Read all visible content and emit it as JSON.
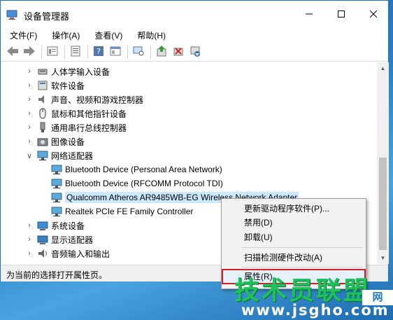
{
  "window": {
    "title": "设备管理器"
  },
  "titlebar": {
    "minimize_icon": "minimize-icon",
    "maximize_icon": "maximize-icon",
    "close_icon": "close-icon"
  },
  "menubar": {
    "items": [
      {
        "label": "文件(F)"
      },
      {
        "label": "操作(A)"
      },
      {
        "label": "查看(V)"
      },
      {
        "label": "帮助(H)"
      }
    ]
  },
  "toolbar": {
    "buttons": [
      "back-icon",
      "forward-icon",
      "properties-view-icon",
      "device-list-icon",
      "help-icon",
      "console-icon",
      "monitor-icon",
      "update-driver-icon",
      "disable-device-icon",
      "uninstall-device-icon"
    ]
  },
  "tree": {
    "rows": [
      {
        "label": "人体学输入设备",
        "expanded": false,
        "icon": "hid-icon"
      },
      {
        "label": "软件设备",
        "expanded": false,
        "icon": "software-device-icon"
      },
      {
        "label": "声音、视频和游戏控制器",
        "expanded": false,
        "icon": "speaker-icon"
      },
      {
        "label": "鼠标和其他指针设备",
        "expanded": false,
        "icon": "mouse-icon"
      },
      {
        "label": "通用串行总线控制器",
        "expanded": false,
        "icon": "usb-icon"
      },
      {
        "label": "图像设备",
        "expanded": false,
        "icon": "camera-icon"
      },
      {
        "label": "网络适配器",
        "expanded": true,
        "icon": "network-adapter-icon"
      },
      {
        "label": "Bluetooth Device (Personal Area Network)",
        "child": true,
        "icon": "network-adapter-icon"
      },
      {
        "label": "Bluetooth Device (RFCOMM Protocol TDI)",
        "child": true,
        "icon": "network-adapter-icon"
      },
      {
        "label": "Qualcomm Atheros AR9485WB-EG Wireless Network Adapter",
        "child": true,
        "selected": true,
        "icon": "network-adapter-icon"
      },
      {
        "label": "Realtek PCIe FE Family Controller",
        "child": true,
        "icon": "network-adapter-icon"
      },
      {
        "label": "系统设备",
        "expanded": false,
        "icon": "system-device-icon"
      },
      {
        "label": "显示适配器",
        "expanded": false,
        "icon": "display-adapter-icon"
      },
      {
        "label": "音频输入和输出",
        "expanded": false,
        "icon": "audio-icon"
      }
    ]
  },
  "statusbar": {
    "text": "为当前的选择打开属性页。"
  },
  "context_menu": {
    "items": [
      {
        "label": "更新驱动程序软件(P)..."
      },
      {
        "label": "禁用(D)"
      },
      {
        "label": "卸载(U)"
      },
      {
        "label": "扫描检测硬件改动(A)"
      },
      {
        "label": "属性(R)",
        "highlighted": true
      }
    ]
  },
  "watermark": {
    "logo": "技术员联盟",
    "url": "www.jsgho.com",
    "badge": "网"
  },
  "colors": {
    "accent": "#1a73c8",
    "selection": "#cce8ff",
    "highlight_border": "#d41f2a",
    "watermark_green": "#1ec25a"
  }
}
